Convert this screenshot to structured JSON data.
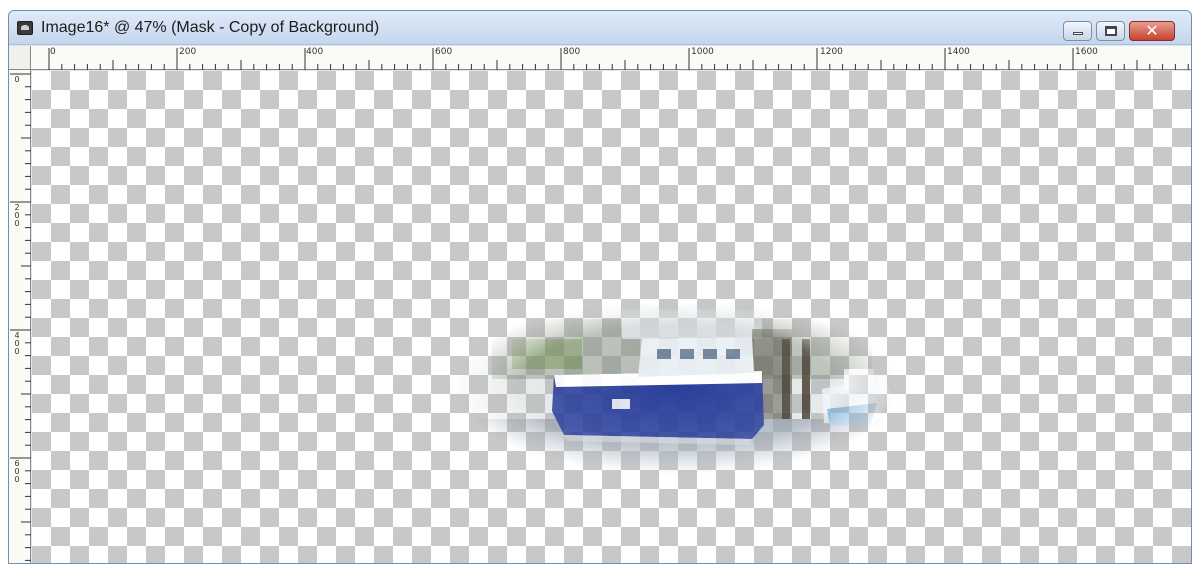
{
  "window": {
    "title": "Image16* @  47% (Mask - Copy of Background)",
    "close_glyph": "✕"
  },
  "rulers": {
    "horizontal_labels": [
      "0",
      "200",
      "400",
      "600",
      "800",
      "1000",
      "1200",
      "1400",
      "1600"
    ],
    "vertical_labels": [
      "0",
      "200",
      "400",
      "600"
    ]
  },
  "canvas": {
    "zoom_percent": 47,
    "transparency_checker_color": "#c8c8c8",
    "layer": "Mask - Copy of Background"
  },
  "photo": {
    "subject": "fishing-boat",
    "hull_color": "#2a3f9a"
  }
}
